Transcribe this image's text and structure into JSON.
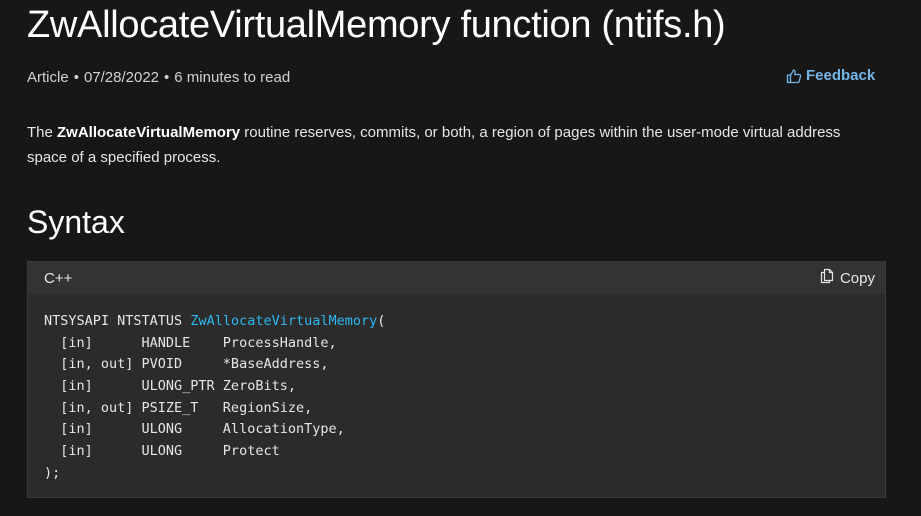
{
  "title": "ZwAllocateVirtualMemory function (ntifs.h)",
  "meta": {
    "type": "Article",
    "date": "07/28/2022",
    "read_time": "6 minutes to read",
    "separator": "•"
  },
  "feedback": {
    "label": "Feedback",
    "icon": "thumbs-up-icon",
    "color": "#75b6e7"
  },
  "intro": {
    "prefix": "The ",
    "bold": "ZwAllocateVirtualMemory",
    "suffix": " routine reserves, commits, or both, a region of pages within the user-mode virtual address space of a specified process."
  },
  "syntax": {
    "heading": "Syntax",
    "language": "C++",
    "copy_label": "Copy",
    "copy_icon": "copy-icon",
    "function_color": "#2cb8f2",
    "signature_prefix": "NTSYSAPI NTSTATUS ",
    "function_name": "ZwAllocateVirtualMemory",
    "signature_suffix": "(",
    "params": [
      "  [in]      HANDLE    ProcessHandle,",
      "  [in, out] PVOID     *BaseAddress,",
      "  [in]      ULONG_PTR ZeroBits,",
      "  [in, out] PSIZE_T   RegionSize,",
      "  [in]      ULONG     AllocationType,",
      "  [in]      ULONG     Protect"
    ],
    "closing": ");"
  }
}
